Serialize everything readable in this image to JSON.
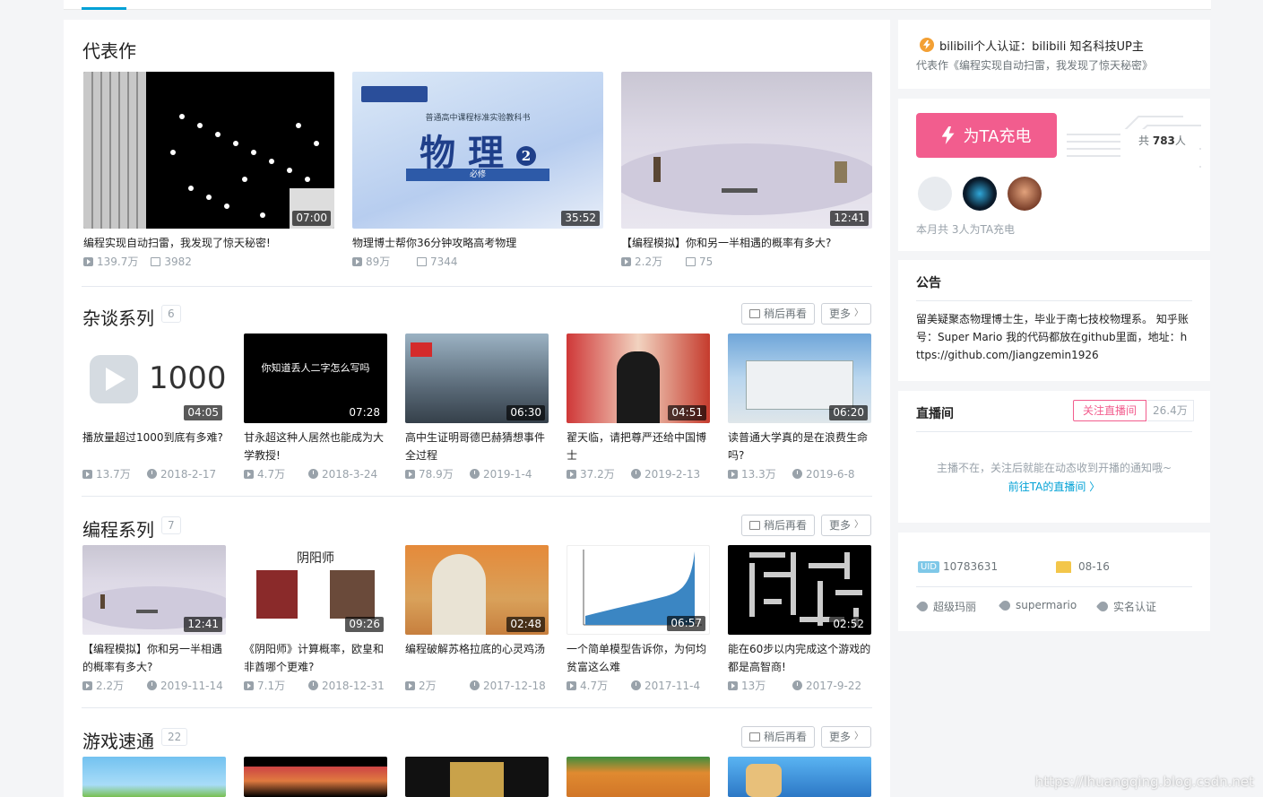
{
  "representative": {
    "title": "代表作",
    "items": [
      {
        "title": "编程实现自动扫雷，我发现了惊天秘密!",
        "duration": "07:00",
        "views": "139.7万",
        "danmaku": "3982",
        "thumb": "t-grid"
      },
      {
        "title": "物理博士帮你36分钟攻略高考物理",
        "duration": "35:52",
        "views": "89万",
        "danmaku": "7344",
        "thumb": "t-blue"
      },
      {
        "title": "【编程模拟】你和另一半相遇的概率有多大?",
        "duration": "12:41",
        "views": "2.2万",
        "danmaku": "75",
        "thumb": "t-winter"
      }
    ]
  },
  "physics_book": {
    "line1": "普通高中课程标准实验教科书",
    "main": "物 理",
    "num": "2",
    "sub": "必修"
  },
  "sections": [
    {
      "title": "杂谈系列",
      "count": "6",
      "later": "稍后再看",
      "more": "更多",
      "items": [
        {
          "title": "播放量超过1000到底有多难?",
          "duration": "04:05",
          "views": "13.7万",
          "date": "2018-2-17",
          "thumb": "t-gray",
          "overlay": "1000"
        },
        {
          "title": "甘永超这种人居然也能成为大学教授!",
          "duration": "07:28",
          "views": "4.7万",
          "date": "2018-3-24",
          "thumb": "t-black",
          "overlay": "你知道丢人二字怎么写吗"
        },
        {
          "title": "高中生证明哥德巴赫猜想事件全过程",
          "duration": "06:30",
          "views": "78.9万",
          "date": "2019-1-4",
          "thumb": "t-class"
        },
        {
          "title": "翟天临，请把尊严还给中国博士",
          "duration": "04:51",
          "views": "37.2万",
          "date": "2019-2-13",
          "thumb": "t-grad"
        },
        {
          "title": "读普通大学真的是在浪费生命吗?",
          "duration": "06:20",
          "views": "13.3万",
          "date": "2019-6-8",
          "thumb": "t-building"
        }
      ]
    },
    {
      "title": "编程系列",
      "count": "7",
      "later": "稍后再看",
      "more": "更多",
      "items": [
        {
          "title": "【编程模拟】你和另一半相遇的概率有多大?",
          "duration": "12:41",
          "views": "2.2万",
          "date": "2019-11-14",
          "thumb": "t-winter"
        },
        {
          "title": "《阴阳师》计算概率，欧皇和非酋哪个更难?",
          "duration": "09:26",
          "views": "7.1万",
          "date": "2018-12-31",
          "thumb": "t-white",
          "overlay": "阴阳师"
        },
        {
          "title": "编程破解苏格拉底的心灵鸡汤",
          "duration": "02:48",
          "views": "2万",
          "date": "2017-12-18",
          "thumb": "t-desert"
        },
        {
          "title": "一个简单模型告诉你，为何均贫富这么难",
          "duration": "06:57",
          "views": "4.7万",
          "date": "2017-11-4",
          "thumb": "t-chart"
        },
        {
          "title": "能在60步以内完成这个游戏的都是高智商!",
          "duration": "02:52",
          "views": "13万",
          "date": "2017-9-22",
          "thumb": "t-pixel"
        }
      ]
    },
    {
      "title": "游戏速通",
      "count": "22",
      "later": "稍后再看",
      "more": "更多",
      "items": [
        {
          "thumb": "t-game1"
        },
        {
          "thumb": "t-game2"
        },
        {
          "thumb": "t-game3"
        },
        {
          "thumb": "t-game4"
        },
        {
          "thumb": "t-game5"
        }
      ]
    }
  ],
  "sidebar": {
    "cert": {
      "text": "bilibili个人认证：bilibili 知名科技UP主",
      "sub": "代表作《编程实现自动扫雷，我发现了惊天秘密》"
    },
    "charge": {
      "button": "为TA充电",
      "total_prefix": "共",
      "total_count": "783",
      "total_suffix": "人",
      "month_text": "本月共 3人为TA充电"
    },
    "notice": {
      "title": "公告",
      "text": "留美疑聚态物理博士生，毕业于南七技校物理系。 知乎账号：Super Mario 我的代码都放在github里面，地址：https://github.com/Jiangzemin1926"
    },
    "live": {
      "title": "直播间",
      "follow": "关注直播间",
      "count": "26.4万",
      "off_text": "主播不在，关注后就能在动态收到开播的通知哦~",
      "link": "前往TA的直播间"
    },
    "info": {
      "uid_label": "UID",
      "uid": "10783631",
      "birthday": "08-16",
      "tags": [
        "超级玛丽",
        "supermario",
        "实名认证"
      ]
    }
  },
  "watermark": "https://lhuangqing.blog.csdn.net",
  "colors": {
    "accent": "#00a1d6",
    "pink": "#f25d8e",
    "gold": "#f3a034"
  }
}
